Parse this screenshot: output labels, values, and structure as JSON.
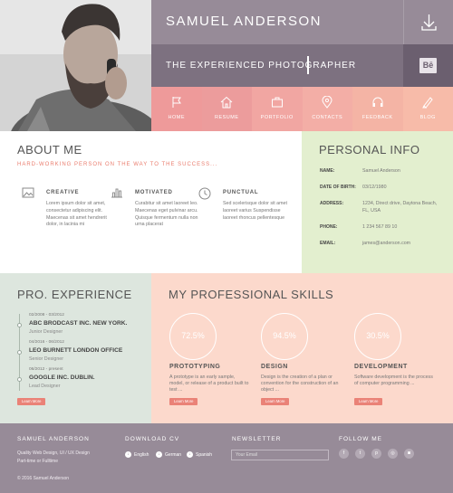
{
  "header": {
    "name": "SAMUEL ANDERSON",
    "subtitle": "THE EXPERIENCED PHOTOGRAPHER",
    "behance_label": "Bē"
  },
  "nav": [
    {
      "label": "HOME",
      "icon": "flag-icon",
      "color": "#ee9a9a"
    },
    {
      "label": "RESUME",
      "icon": "home-icon",
      "color": "#ec9c9c"
    },
    {
      "label": "PORTFOLIO",
      "icon": "briefcase-icon",
      "color": "#f1a6a2"
    },
    {
      "label": "CONTACTS",
      "icon": "location-pin-icon",
      "color": "#f3aea6"
    },
    {
      "label": "FEEDBACK",
      "icon": "headset-icon",
      "color": "#f4b4a5"
    },
    {
      "label": "BLOG",
      "icon": "pen-icon",
      "color": "#f7bba9"
    }
  ],
  "about": {
    "title": "ABOUT ME",
    "tagline": "HARD-WORKING PERSON ON THE WAY TO THE SUCCESS...",
    "features": [
      {
        "icon": "picture-icon",
        "title": "CREATIVE",
        "text": "Lorem ipsum dolor sit amet, consectetur adipiscing elit. Maecenas sit amet hendrerit dolor, in lacinia mi"
      },
      {
        "icon": "bar-chart-icon",
        "title": "MOTIVATED",
        "text": "Curabitur sit amet laoreet leo. Maecenas eget pulvinar arcu. Quisque fermentum nulla non urna placerat"
      },
      {
        "icon": "clock-icon",
        "title": "PUNCTUAL",
        "text": "Sed scelerisque dolor sit amet laoreet varius Suspendisse laoreet rhoncus pellentesque"
      }
    ]
  },
  "info": {
    "title": "PERSONAL INFO",
    "rows": [
      {
        "label": "NAME:",
        "value": "Samuel Anderson"
      },
      {
        "label": "DATE OF BIRTH:",
        "value": "03/12/1980"
      },
      {
        "label": "ADDRESS:",
        "value": "1234, Direct drive, Daytona Beach, FL, USA"
      },
      {
        "label": "PHONE:",
        "value": "1 234 567 89 10"
      },
      {
        "label": "EMAIL:",
        "value": "james@anderson.com"
      }
    ]
  },
  "experience": {
    "title": "PRO. EXPERIENCE",
    "jobs": [
      {
        "date": "02/2008 - 03/2012",
        "company": "ABC BRODCAST INC. NEW YORK.",
        "role": "Junior Designer"
      },
      {
        "date": "04/2016 - 06/2012",
        "company": "LEO BURNETT LONDON OFFICE",
        "role": "Senior Designer"
      },
      {
        "date": "06/2012 - present",
        "company": "GOOGLE INC. DUBLIN.",
        "role": "Lead Designer"
      }
    ],
    "button": "Learn More"
  },
  "skills": {
    "title": "MY PROFESSIONAL SKILLS",
    "items": [
      {
        "percent": "72.5%",
        "value": 72.5,
        "title": "PROTOTYPING",
        "text": "A prototype is an early sample, model, or release of a product built to test ..."
      },
      {
        "percent": "94.5%",
        "value": 94.5,
        "title": "DESIGN",
        "text": "Design is the creation of a plan or convention for the construction of an object ..."
      },
      {
        "percent": "30.5%",
        "value": 30.5,
        "title": "DEVELOPMENT",
        "text": "Software development is the process of computer programming ..."
      }
    ],
    "button": "Learn More"
  },
  "footer": {
    "about_title": "SAMUEL ANDERSON",
    "about_line1": "Quality Web Design, UI / UX Design",
    "about_line2": "Part-time or Fulltime",
    "copyright": "© 2016 Samuel Anderson",
    "download_title": "DOWNLOAD CV",
    "languages": [
      "English",
      "German",
      "Spanish"
    ],
    "newsletter_title": "NEWSLETTER",
    "newsletter_placeholder": "Your Email",
    "follow_title": "FOLLOW ME",
    "social_icons": [
      "facebook-icon",
      "twitter-icon",
      "pinterest-icon",
      "instagram-icon",
      "camera-icon"
    ]
  },
  "colors": {
    "accent": "#ea7d6e",
    "header_bg": "#978b98",
    "info_bg": "#e3efcf",
    "experience_bg": "#dde6de",
    "skills_bg": "#fcd9cc"
  }
}
